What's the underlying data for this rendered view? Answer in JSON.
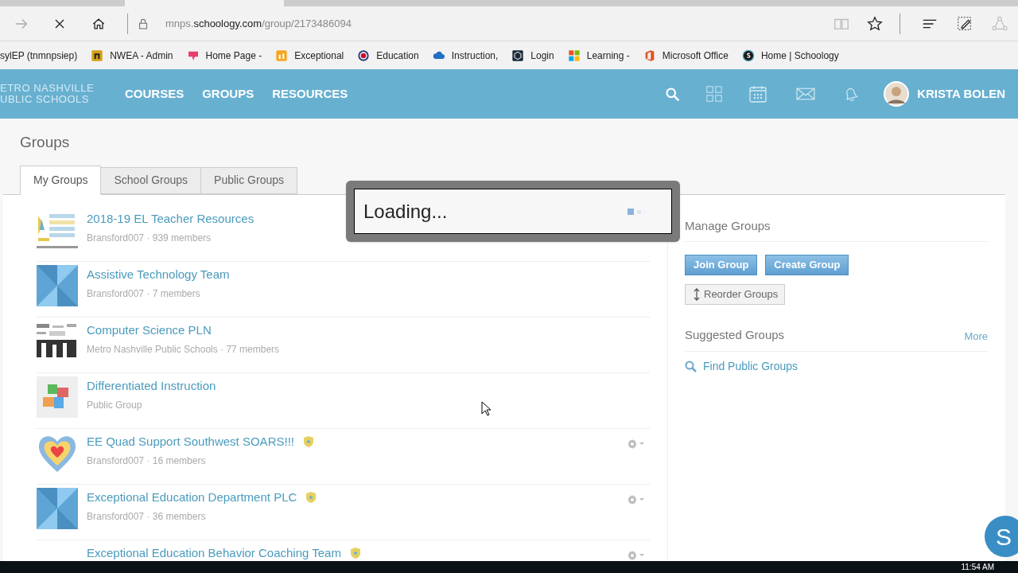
{
  "browser": {
    "url_prefix": "mnps.",
    "url_domain": "schoology.com",
    "url_path": "/group/2173486094"
  },
  "bookmarks": [
    {
      "label": "sylEP (tnmnpsiep)",
      "kind": "plain"
    },
    {
      "label": "NWEA - Admin",
      "kind": "nwea"
    },
    {
      "label": "Home Page -",
      "kind": "pink"
    },
    {
      "label": "Exceptional",
      "kind": "orange"
    },
    {
      "label": "Education",
      "kind": "seal"
    },
    {
      "label": "Instruction,",
      "kind": "cloud"
    },
    {
      "label": "Login",
      "kind": "hex"
    },
    {
      "label": "Learning -",
      "kind": "windows"
    },
    {
      "label": "Microsoft Office",
      "kind": "office"
    },
    {
      "label": "Home | Schoology",
      "kind": "schoology"
    }
  ],
  "nav": {
    "logo_lines": [
      "ETRO NASHVILLE",
      "UBLIC SCHOOLS"
    ],
    "links": [
      "COURSES",
      "GROUPS",
      "RESOURCES"
    ],
    "user": "KRISTA BOLEN"
  },
  "page_title": "Groups",
  "tabs": [
    {
      "label": "My Groups",
      "selected": true
    },
    {
      "label": "School Groups",
      "selected": false
    },
    {
      "label": "Public Groups",
      "selected": false
    }
  ],
  "groups": [
    {
      "title": "2018-19 EL Teacher Resources",
      "meta": "Bransford007 · 939 members",
      "kind": "logo",
      "badge": false,
      "menu": false
    },
    {
      "title": "Assistive Technology Team",
      "meta": "Bransford007 · 7 members",
      "kind": "tiles",
      "badge": false,
      "menu": false
    },
    {
      "title": "Computer Science PLN",
      "meta": "Metro Nashville Public Schools · 77 members",
      "kind": "words",
      "badge": false,
      "menu": false
    },
    {
      "title": "Differentiated Instruction",
      "meta": "Public Group",
      "kind": "puzzle",
      "badge": false,
      "menu": false
    },
    {
      "title": "EE Quad Support Southwest SOARS!!!",
      "meta": "Bransford007 · 16 members",
      "kind": "heart",
      "badge": true,
      "menu": true
    },
    {
      "title": "Exceptional Education Department PLC",
      "meta": "Bransford007 · 36 members",
      "kind": "tiles",
      "badge": true,
      "menu": true
    },
    {
      "title": "Exceptional Education Behavior Coaching Team",
      "kind": "plain",
      "badge": true,
      "menu": true
    }
  ],
  "sidebar": {
    "manage_title": "Manage Groups",
    "buttons": [
      "Join Group",
      "Create Group"
    ],
    "reorder": "Reorder Groups",
    "suggested_title": "Suggested Groups",
    "more": "More",
    "find": "Find Public Groups"
  },
  "loading": "Loading...",
  "chat_button": "S",
  "clock": "11:54 AM"
}
